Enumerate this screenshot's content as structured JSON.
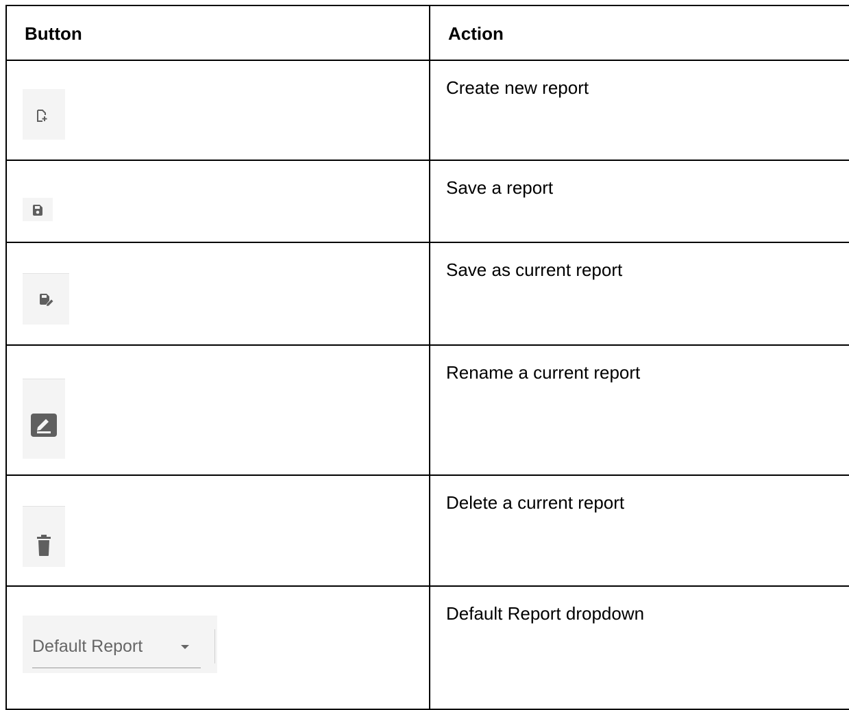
{
  "table": {
    "headers": {
      "button": "Button",
      "action": "Action"
    },
    "rows": [
      {
        "icon": "new-report-icon",
        "action": "Create new report"
      },
      {
        "icon": "save-icon",
        "action": "Save a report"
      },
      {
        "icon": "save-as-icon",
        "action": "Save as current report"
      },
      {
        "icon": "rename-icon",
        "action": "Rename a current report"
      },
      {
        "icon": "delete-icon",
        "action": "Delete a current report"
      },
      {
        "icon": "dropdown-caret-icon",
        "action": "Default Report dropdown",
        "dropdown_value": "Default Report"
      }
    ]
  },
  "colors": {
    "icon": "#5f5f5f",
    "swatch": "#f4f4f4",
    "border": "#000000"
  }
}
